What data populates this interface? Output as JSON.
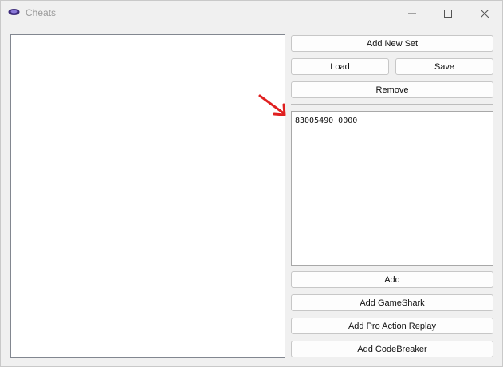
{
  "window": {
    "title": "Cheats",
    "app_icon": "controller-icon",
    "controls": {
      "minimize": "minimize-icon",
      "maximize": "maximize-icon",
      "close": "close-icon"
    }
  },
  "buttons": {
    "add_new_set": "Add New Set",
    "load": "Load",
    "save": "Save",
    "remove": "Remove",
    "add": "Add",
    "add_gameshark": "Add GameShark",
    "add_par": "Add Pro Action Replay",
    "add_codebreaker": "Add CodeBreaker"
  },
  "code_editor": {
    "text": "83005490 0000"
  },
  "annotation": {
    "arrow_color": "#e02020"
  }
}
